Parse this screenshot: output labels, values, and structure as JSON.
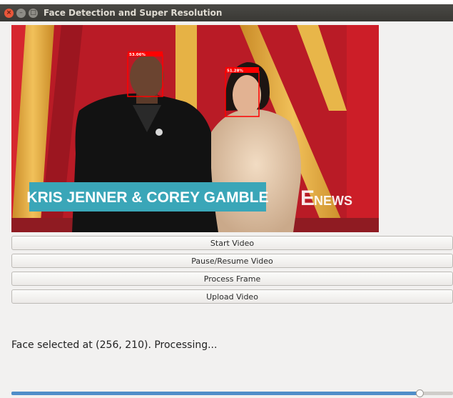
{
  "window": {
    "title": "Face Detection and Super Resolution",
    "controls": {
      "close": "×",
      "minimize": "–",
      "maximize": "□"
    }
  },
  "video_frame": {
    "banner_text": "KRIS JENNER & COREY GAMBLE",
    "watermark": {
      "e": "E",
      "news": "NEWS"
    },
    "detections": [
      {
        "label": "53.06%",
        "color": "#ff0000"
      },
      {
        "label": "51.28%",
        "color": "#ff0000"
      }
    ]
  },
  "buttons": {
    "start": "Start Video",
    "pause_resume": "Pause/Resume Video",
    "process_frame": "Process Frame",
    "upload": "Upload Video"
  },
  "status": {
    "text": "Face selected at (256, 210). Processing..."
  },
  "progress": {
    "value": 0.925,
    "fill_color": "#4f8ec9"
  },
  "colors": {
    "titlebar": "#3c3b37",
    "window_bg": "#f2f1f0",
    "banner": "#3aa6b8",
    "backdrop_red": "#c0202a",
    "backdrop_gold": "#e2a93a"
  }
}
